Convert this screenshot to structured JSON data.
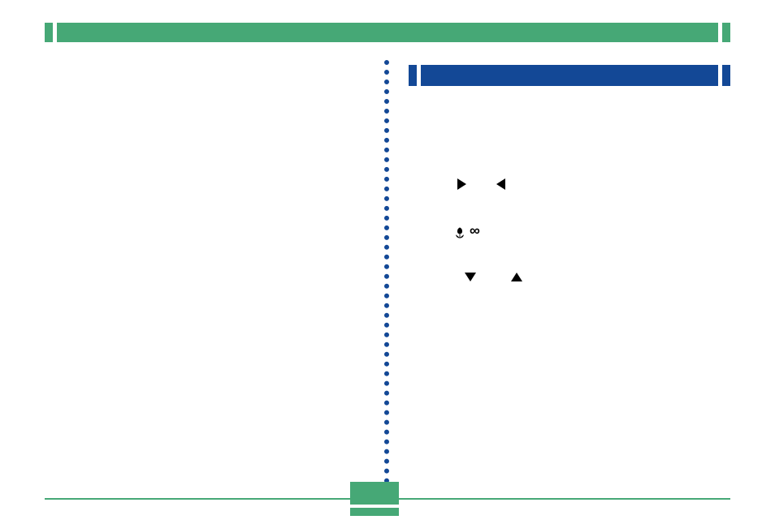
{
  "page_number": "",
  "topbar_title": "",
  "rightbar_title": "",
  "icons": {
    "right_arrow": "navigate-right",
    "left_arrow": "navigate-left",
    "down_arrow": "navigate-down",
    "up_arrow": "navigate-up",
    "macro": "macro-tulip",
    "infinity": "∞"
  },
  "colors": {
    "green": "#46a876",
    "blue": "#134896"
  }
}
